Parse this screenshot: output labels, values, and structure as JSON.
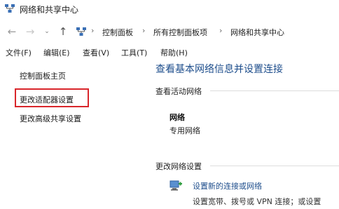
{
  "window": {
    "title": "网络和共享中心"
  },
  "navigation": {
    "back_icon": "←",
    "forward_icon": "→",
    "dropdown_icon": "⌄",
    "up_icon": "↑",
    "breadcrumbs": [
      "控制面板",
      "所有控制面板项",
      "网络和共享中心"
    ],
    "separator": "›"
  },
  "menu": [
    "文件(F)",
    "编辑(E)",
    "查看(V)",
    "工具(T)",
    "帮助(H)"
  ],
  "sidebar": {
    "items": [
      "控制面板主页",
      "更改适配器设置",
      "更改高级共享设置"
    ],
    "highlight_color": "#d9262b"
  },
  "main": {
    "title": "查看基本网络信息并设置连接",
    "active_networks_label": "查看活动网络",
    "network_name": "网络",
    "network_type": "专用网络",
    "change_settings_label": "更改网络设置",
    "setup_link": "设置新的连接或网络",
    "setup_desc": "设置宽带、拨号或 VPN 连接；或设置"
  },
  "colors": {
    "link_blue": "#1e4e8c",
    "highlight_red": "#d9262b"
  }
}
